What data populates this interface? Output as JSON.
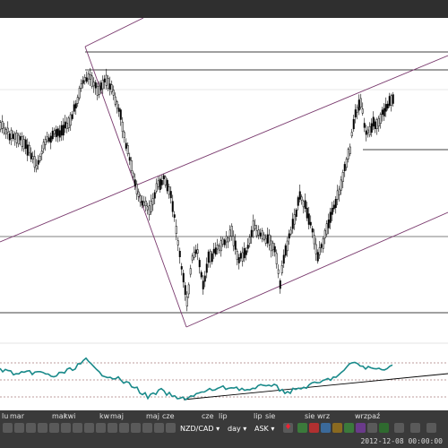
{
  "x_axis_labels": [
    "lu",
    "mar",
    "mar",
    "kwi",
    "kw",
    "maj",
    "maj",
    "cze",
    "cze",
    "lip",
    "lip",
    "sie",
    "sie",
    "wrz",
    "wrz",
    "paź"
  ],
  "toolbar": {
    "symbol": "NZD/CAD",
    "timeframe": "day",
    "price_side": "ASK"
  },
  "status": {
    "timestamp": "2012-12-08 00:00:00"
  },
  "colors": {
    "candles": "#000000",
    "channel_lines": "#7a3a6e",
    "oscillator": "#1a8a8a",
    "oscillator_levels": "#7a3a3a",
    "toolbar_bg": "#3a3a3a",
    "chart_bg": "#ffffff"
  },
  "chart_data": {
    "type": "candlestick",
    "title": "",
    "series": [],
    "indicator": {
      "type": "line"
    },
    "grid": false,
    "legend": "none"
  }
}
